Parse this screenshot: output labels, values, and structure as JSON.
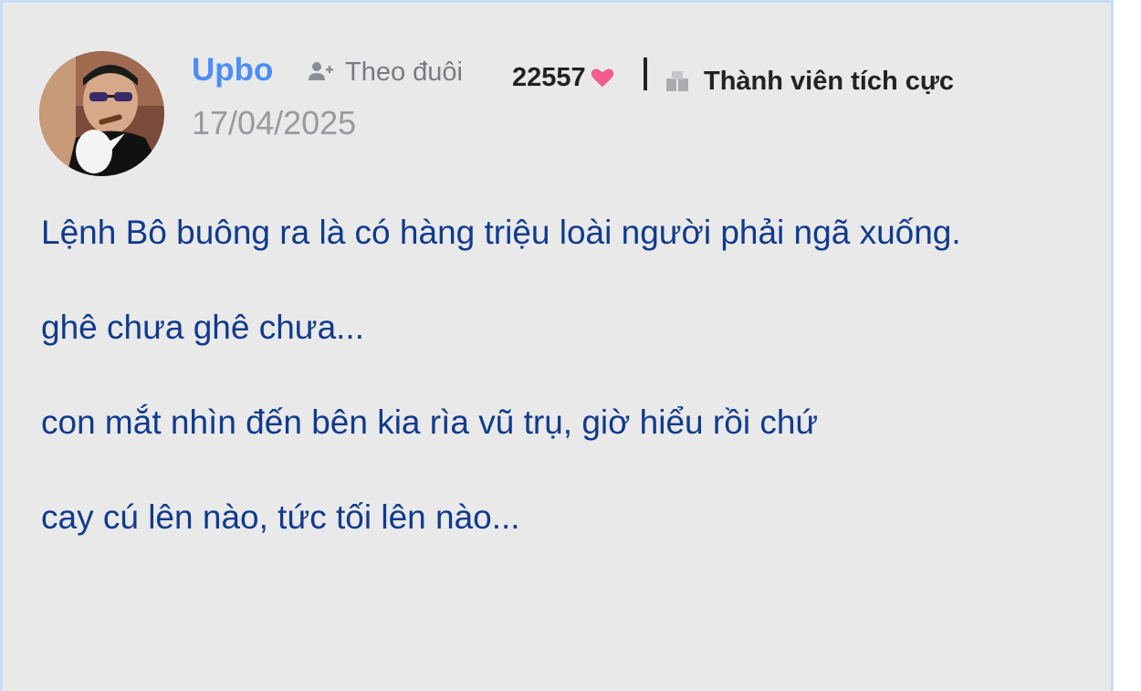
{
  "post": {
    "author": "Upbo",
    "follow_label": "Theo đuôi",
    "date": "17/04/2025",
    "likes": "22557",
    "rank": "Thành viên tích cực",
    "paragraphs": [
      "Lệnh Bô buông ra là có hàng triệu loài người phải ngã xuống.",
      "ghê chưa ghê chưa...",
      "con mắt nhìn đến bên kia rìa vũ trụ, giờ hiểu rồi chứ",
      "cay cú lên nào, tức tối lên nào..."
    ]
  },
  "icons": {
    "follow": "user-plus-icon",
    "likes": "heart-icon",
    "rank": "member-rank-icon"
  },
  "colors": {
    "username": "#4c8df6",
    "body_text": "#103a8c",
    "heart": "#f35d8b",
    "card_bg": "#e9e9ea"
  }
}
